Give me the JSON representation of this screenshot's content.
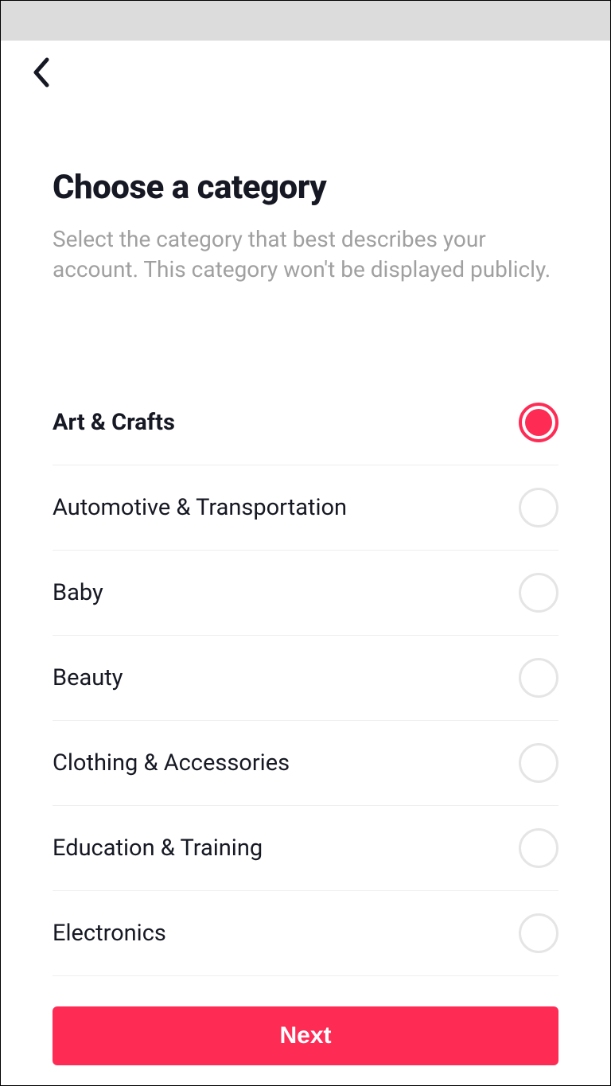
{
  "header": {
    "title": "Choose a category",
    "subtitle": "Select the category that best describes your account. This category won't be displayed publicly."
  },
  "categories": [
    {
      "label": "Art & Crafts",
      "selected": true
    },
    {
      "label": "Automotive & Transportation",
      "selected": false
    },
    {
      "label": "Baby",
      "selected": false
    },
    {
      "label": "Beauty",
      "selected": false
    },
    {
      "label": "Clothing & Accessories",
      "selected": false
    },
    {
      "label": "Education & Training",
      "selected": false
    },
    {
      "label": "Electronics",
      "selected": false
    }
  ],
  "footer": {
    "next_label": "Next"
  },
  "colors": {
    "accent": "#fe2c55"
  }
}
